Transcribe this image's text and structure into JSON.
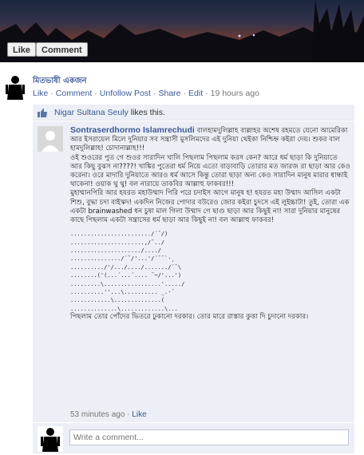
{
  "photo": {
    "like_label": "Like",
    "comment_label": "Comment"
  },
  "post": {
    "author": "মিতভাষী একজন",
    "actions": {
      "like": "Like",
      "comment": "Comment",
      "unfollow": "Unfollow Post",
      "share": "Share",
      "edit": "Edit",
      "time": "19 hours ago"
    },
    "likes": {
      "name": "Nigar Sultana Seuly",
      "suffix": " likes this."
    }
  },
  "comment": {
    "author": "Sontraserdhormo Islamrechudi",
    "p1": "বালহামদুলিল্লাহ বাল্লাহর অশেষ রহমতে যেনো আমেরিকা আর ইসরায়েল মিলে দুনিয়ার সব সন্ত্রাসী মুসলিমদের এই দুনিয়া থেইকা নিশ্চিহ্ন কইরা দেয়। শুকর বাল হামদুলিল্লাহ! চোদানাল্লাহ!!!",
    "p2": "ওই শুওরের পুত গে শুওর সারাদিন খালি পিছলাম পিছলাম করস কেন? আরে ধর্ম ছাড়া কি দুনিয়াতে আর কিছু বুঝস না????! খাঙ্কির পুতেরা ধর্ম নিয়ে এতো বাড়াবাড়ি তোরার মত জারজ রা ছাড়া আর কেও করেনা। ওরে মাদারি দুনিয়াতে আরও ধর্ম আসে কিন্তু তোরা ছাড়া অন্য কেও সারাদিন মানুষ মারার ধান্ধাই থাকেনা! ওয়াক থু থু! বল নারায়ে তাকবির আল্লাহু ফাকবর!!!",
    "p3": "মুহাম্মানপিরি আর হযরত মহাউম্মাদ পিরি পরে চদাইস আগে মানুষ হ! হযরত মহা উম্মাদ আসিল একটা শিশু, বুদ্ধা চদা বাইস্কদ! একদিন নিজের পোদার বউরেও জোর কইরা চুদসে এই লুইচ্চাটা! তুই, তোরা এক একটা brainwashed ধন চুষা মাল গিলা উম্মাদ গে ছাগু ছাড়া আর কিছুই না! সারা দুনিয়ার মানুষের কাছে পিছলাম একটা সন্ত্রাসের ধর্ম ছাড়া আর কিছুই না! বল আল্লাহু ফাকবর!",
    "art": "......................../´¯/)\n......................,/¯../\n...................../..../\n.............../´¯/'...'/´¯¯`·¸\n........../'/.../..../......./¨¯\\\n........('(...´...´.... ¯~/'...')\n.........\\.................'...../\n..........''...\\.......... _.·´\n............\\..............(\n..............\\.............\\...",
    "p4": "পিছলাম তোর পোঁদের ভিতরে ঢুকানো দরকার। তোর মারে রাস্তার কুত্তা দি চুদানো দরকার।",
    "time": "53 minutes ago",
    "like": "Like"
  },
  "write": {
    "placeholder": "Write a comment..."
  },
  "colors": {
    "link": "#3b5998",
    "panel": "#eceff5"
  }
}
